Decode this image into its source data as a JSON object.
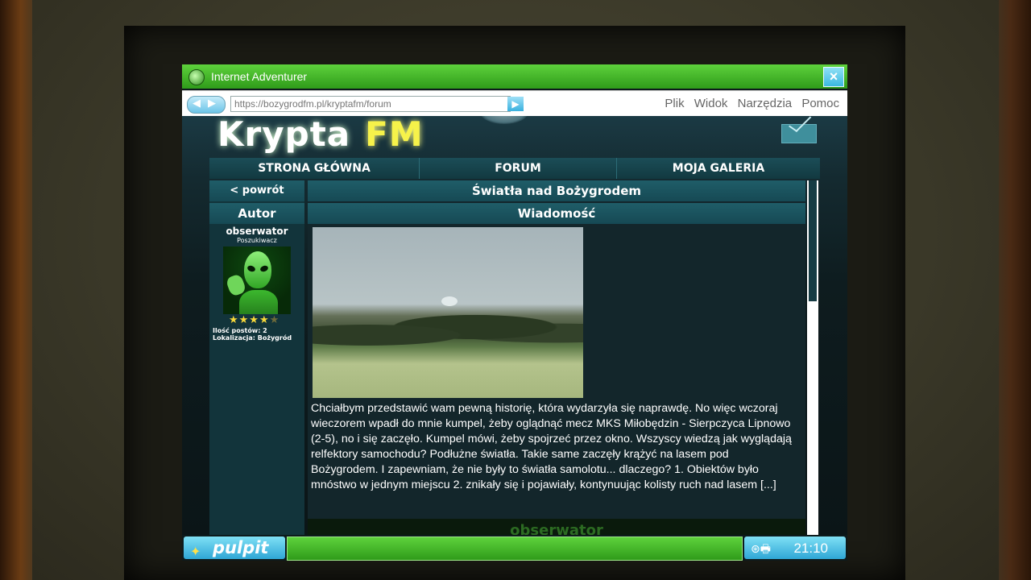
{
  "window": {
    "title": "Internet Adventurer",
    "close": "×"
  },
  "address_bar": {
    "back": "◀",
    "forward": "▶",
    "url": "https://bozygrodfm.pl/kryptafm/forum",
    "go": "▶"
  },
  "menu": {
    "file": "Plik",
    "view": "Widok",
    "tools": "Narzędzia",
    "help": "Pomoc"
  },
  "site": {
    "logo_part1": "Krypta",
    "logo_part2": "FM"
  },
  "nav": {
    "home": "STRONA GŁÓWNA",
    "forum": "FORUM",
    "gallery": "MOJA GALERIA"
  },
  "thread": {
    "back": "< powrót",
    "title": "Światła nad Bożygrodem",
    "author_header": "Autor",
    "message_header": "Wiadomość"
  },
  "author": {
    "username": "obserwator",
    "rank": "Poszukiwacz",
    "rating": 4,
    "rating_max": 5,
    "star_on": "★★★★",
    "star_off": "★",
    "post_count": "Ilość postów: 2",
    "location": "Lokalizacja: Bożygród"
  },
  "post": {
    "text": "Chciałbym przedstawić wam pewną historię, która wydarzyła się naprawdę. No więc wczoraj wieczorem wpadł do mnie kumpel, żeby oglądnąć mecz MKS Miłobędzin - Sierpczyca Lipnowo (2-5), no i się zaczęło. Kumpel mówi, żeby spojrzeć przez okno. Wszyscy wiedzą jak wyglądają relfektory samochodu? Podłużne światła. Takie same zaczęły krążyć na lasem pod Bożygrodem. I zapewniam, że nie były to światła samolotu... dlaczego? 1. Obiektów było mnóstwo w jednym miejscu 2. znikały się i pojawiały, kontynuując kolisty ruch nad lasem [...]",
    "next_author": "obserwator"
  },
  "taskbar": {
    "start_icon": "✦",
    "start_label": "pulpit",
    "tray_icons": "⊛🖶",
    "clock": "21:10"
  },
  "colors": {
    "accent_green": "#2f9b1a",
    "accent_blue": "#2fa7d6",
    "logo_yellow": "#f6f24a"
  }
}
